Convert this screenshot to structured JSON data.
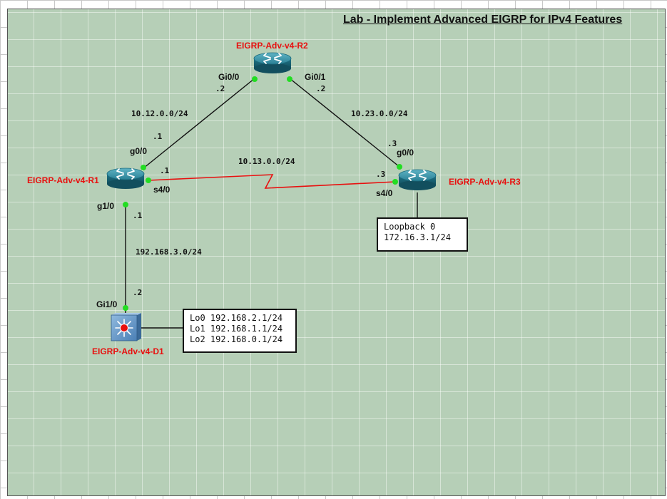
{
  "title": "Lab - Implement Advanced EIGRP for IPv4 Features",
  "colors": {
    "device_label": "#e8100f",
    "port_dot": "#22dd22",
    "serial_link": "#e8100f",
    "ethernet_link": "#111111"
  },
  "devices": {
    "r1": {
      "name": "EIGRP-Adv-v4-R1",
      "icon": "router-icon"
    },
    "r2": {
      "name": "EIGRP-Adv-v4-R2",
      "icon": "router-icon"
    },
    "r3": {
      "name": "EIGRP-Adv-v4-R3",
      "icon": "router-icon"
    },
    "d1": {
      "name": "EIGRP-Adv-v4-D1",
      "icon": "multilayer-switch-icon"
    }
  },
  "interfaces": {
    "r1_g0_0": "g0/0",
    "r1_s4_0": "s4/0",
    "r1_g1_0": "g1/0",
    "r2_gi0_0": "Gi0/0",
    "r2_gi0_1": "Gi0/1",
    "r3_g0_0": "g0/0",
    "r3_s4_0": "s4/0",
    "d1_gi1_0": "Gi1/0"
  },
  "host_ids": {
    "r2_gi0_0": ".2",
    "r2_gi0_1": ".2",
    "r1_g0_0": ".1",
    "r1_s4_0": ".1",
    "r1_g1_0": ".1",
    "r3_g0_0": ".3",
    "r3_s4_0": ".3",
    "d1_gi1_0": ".2"
  },
  "networks": {
    "r1_r2": "10.12.0.0/24",
    "r2_r3": "10.23.0.0/24",
    "r1_r3": "10.13.0.0/24",
    "r1_d1": "192.168.3.0/24"
  },
  "notes": {
    "r3_loopback": [
      "Loopback 0",
      "172.16.3.1/24"
    ],
    "d1_loopbacks": [
      "Lo0 192.168.2.1/24",
      "Lo1 192.168.1.1/24",
      "Lo2 192.168.0.1/24"
    ]
  }
}
